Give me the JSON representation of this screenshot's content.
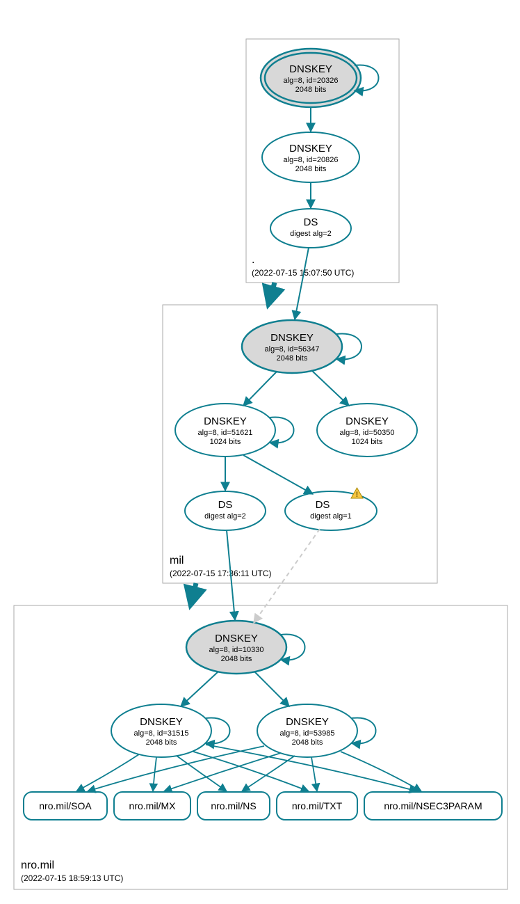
{
  "zones": {
    "root": {
      "label": ".",
      "timestamp": "(2022-07-15 15:07:50 UTC)"
    },
    "mil": {
      "label": "mil",
      "timestamp": "(2022-07-15 17:36:11 UTC)"
    },
    "nro": {
      "label": "nro.mil",
      "timestamp": "(2022-07-15 18:59:13 UTC)"
    }
  },
  "nodes": {
    "root_ksk": {
      "title": "DNSKEY",
      "line2": "alg=8, id=20326",
      "line3": "2048 bits"
    },
    "root_zsk": {
      "title": "DNSKEY",
      "line2": "alg=8, id=20826",
      "line3": "2048 bits"
    },
    "root_ds": {
      "title": "DS",
      "line2": "digest alg=2",
      "line3": ""
    },
    "mil_ksk": {
      "title": "DNSKEY",
      "line2": "alg=8, id=56347",
      "line3": "2048 bits"
    },
    "mil_zsk1": {
      "title": "DNSKEY",
      "line2": "alg=8, id=51621",
      "line3": "1024 bits"
    },
    "mil_zsk2": {
      "title": "DNSKEY",
      "line2": "alg=8, id=50350",
      "line3": "1024 bits"
    },
    "mil_ds1": {
      "title": "DS",
      "line2": "digest alg=2",
      "line3": ""
    },
    "mil_ds2": {
      "title": "DS",
      "line2": "digest alg=1",
      "line3": ""
    },
    "nro_ksk": {
      "title": "DNSKEY",
      "line2": "alg=8, id=10330",
      "line3": "2048 bits"
    },
    "nro_zsk1": {
      "title": "DNSKEY",
      "line2": "alg=8, id=31515",
      "line3": "2048 bits"
    },
    "nro_zsk2": {
      "title": "DNSKEY",
      "line2": "alg=8, id=53985",
      "line3": "2048 bits"
    }
  },
  "rrsets": {
    "soa": "nro.mil/SOA",
    "mx": "nro.mil/MX",
    "ns": "nro.mil/NS",
    "txt": "nro.mil/TXT",
    "nsec3": "nro.mil/NSEC3PARAM"
  }
}
